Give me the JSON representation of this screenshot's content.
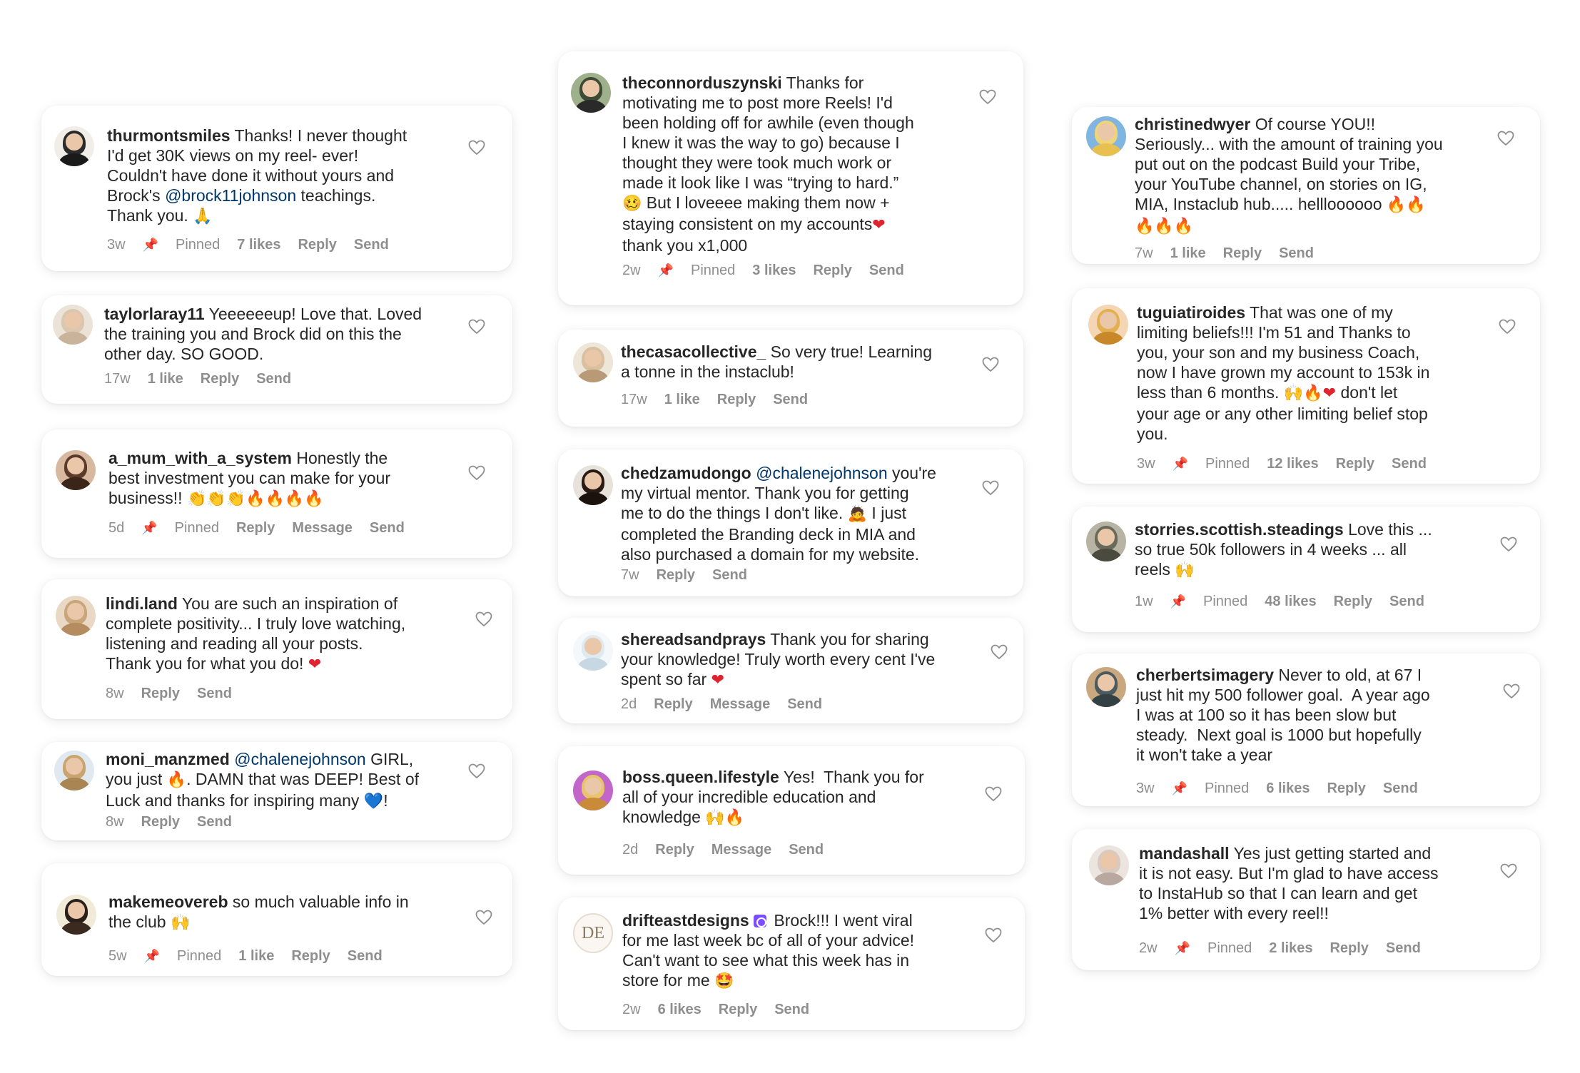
{
  "colors": {
    "text": "#262626",
    "meta": "#8e8e8e",
    "mention": "#00376b",
    "card_bg": "#ffffff"
  },
  "comments": [
    {
      "username": "thurmontsmiles",
      "parts": [
        {
          "text": " Thanks! I never thought"
        },
        {
          "br": true
        },
        {
          "text": "I'd get 30K views on my reel- ever!"
        },
        {
          "br": true
        },
        {
          "text": "Couldn't have done it without yours and"
        },
        {
          "br": true
        },
        {
          "text": "Brock's "
        },
        {
          "mention": "@brock11johnson"
        },
        {
          "text": " teachings."
        },
        {
          "br": true
        },
        {
          "text": "Thank you. "
        },
        {
          "emoji": "🙏",
          "cls": "pray"
        }
      ],
      "time": "3w",
      "pinned": "Pinned",
      "likes": "7 likes",
      "actions": [
        "Reply",
        "Send"
      ],
      "icon": "heart-outline-icon"
    },
    {
      "username": "taylorlaray11",
      "parts": [
        {
          "text": " Yeeeeeeup! Love that. Loved"
        },
        {
          "br": true
        },
        {
          "text": "the training you and Brock did on this the"
        },
        {
          "br": true
        },
        {
          "text": "other day. SO GOOD."
        }
      ],
      "time": "17w",
      "likes": "1 like",
      "actions": [
        "Reply",
        "Send"
      ],
      "icon": "heart-outline-icon"
    },
    {
      "username": "a_mum_with_a_system",
      "parts": [
        {
          "text": " Honestly the"
        },
        {
          "br": true
        },
        {
          "text": "best investment you can make for your"
        },
        {
          "br": true
        },
        {
          "text": "business!! "
        },
        {
          "emoji": "👏👏👏",
          "cls": "clap"
        },
        {
          "emoji": "🔥🔥🔥🔥",
          "cls": "fire"
        }
      ],
      "time": "5d",
      "pinned": "Pinned",
      "actions": [
        "Reply",
        "Message",
        "Send"
      ],
      "icon": "heart-outline-icon"
    },
    {
      "username": "lindi.land",
      "parts": [
        {
          "text": " You are such an inspiration of"
        },
        {
          "br": true
        },
        {
          "text": "complete positivity... I truly love watching,"
        },
        {
          "br": true
        },
        {
          "text": "listening and reading all your posts."
        },
        {
          "br": true
        },
        {
          "text": "Thank you for what you do! "
        },
        {
          "emoji": "❤",
          "cls": "heart"
        }
      ],
      "time": "8w",
      "actions": [
        "Reply",
        "Send"
      ],
      "icon": "heart-outline-icon"
    },
    {
      "username": "moni_manzmed",
      "parts": [
        {
          "text": " "
        },
        {
          "mention": "@chalenejohnson"
        },
        {
          "text": " GIRL,"
        },
        {
          "br": true
        },
        {
          "text": "you just "
        },
        {
          "emoji": "🔥",
          "cls": "fire"
        },
        {
          "text": ". DAMN that was DEEP! Best of"
        },
        {
          "br": true
        },
        {
          "text": "Luck and thanks for inspiring many "
        },
        {
          "emoji": "💙",
          "cls": "blue"
        },
        {
          "text": "!"
        }
      ],
      "time": "8w",
      "actions": [
        "Reply",
        "Send"
      ],
      "icon": "heart-outline-icon"
    },
    {
      "username": "makemeovereb",
      "parts": [
        {
          "text": " so much valuable info in"
        },
        {
          "br": true
        },
        {
          "text": "the club "
        },
        {
          "emoji": "🙌",
          "cls": "yellow"
        }
      ],
      "time": "5w",
      "pinned": "Pinned",
      "likes": "1 like",
      "actions": [
        "Reply",
        "Send"
      ],
      "icon": "heart-outline-icon"
    },
    {
      "username": "theconnorduszynski",
      "parts": [
        {
          "text": " Thanks for"
        },
        {
          "br": true
        },
        {
          "text": "motivating me to post more Reels! I'd"
        },
        {
          "br": true
        },
        {
          "text": "been holding off for awhile (even though"
        },
        {
          "br": true
        },
        {
          "text": "I knew it was the way to go) because I"
        },
        {
          "br": true
        },
        {
          "text": "thought they were took much work or"
        },
        {
          "br": true
        },
        {
          "text": "made it look like I was “trying to hard.”"
        },
        {
          "br": true
        },
        {
          "emoji": "🥴",
          "cls": "yellow"
        },
        {
          "text": " But I loveeee making them now +"
        },
        {
          "br": true
        },
        {
          "text": "staying consistent on my accounts"
        },
        {
          "emoji": "❤",
          "cls": "heart"
        },
        {
          "br": true
        },
        {
          "text": "thank you x1,000"
        }
      ],
      "time": "2w",
      "pinned": "Pinned",
      "likes": "3 likes",
      "actions": [
        "Reply",
        "Send"
      ],
      "icon": "heart-outline-icon"
    },
    {
      "username": "thecasacollective_",
      "parts": [
        {
          "text": " So very true! Learning"
        },
        {
          "br": true
        },
        {
          "text": "a tonne in the instaclub!"
        }
      ],
      "time": "17w",
      "likes": "1 like",
      "actions": [
        "Reply",
        "Send"
      ],
      "icon": "heart-outline-icon"
    },
    {
      "username": "chedzamudongo",
      "parts": [
        {
          "text": " "
        },
        {
          "mention": "@chalenejohnson"
        },
        {
          "text": " you're"
        },
        {
          "br": true
        },
        {
          "text": "my virtual mentor. Thank you for getting"
        },
        {
          "br": true
        },
        {
          "text": "me to do the things I don't like. "
        },
        {
          "emoji": "🙇",
          "cls": "purple"
        },
        {
          "text": " I just"
        },
        {
          "br": true
        },
        {
          "text": "completed the Branding deck in MIA and"
        },
        {
          "br": true
        },
        {
          "text": "also purchased a domain for my website."
        }
      ],
      "time": "7w",
      "actions": [
        "Reply",
        "Send"
      ],
      "icon": "heart-outline-icon"
    },
    {
      "username": "shereadsandprays",
      "parts": [
        {
          "text": " Thank you for sharing"
        },
        {
          "br": true
        },
        {
          "text": "your knowledge! Truly worth every cent I've"
        },
        {
          "br": true
        },
        {
          "text": "spent so far "
        },
        {
          "emoji": "❤",
          "cls": "heart"
        }
      ],
      "time": "2d",
      "actions": [
        "Reply",
        "Message",
        "Send"
      ],
      "icon": "heart-outline-icon"
    },
    {
      "username": "boss.queen.lifestyle",
      "parts": [
        {
          "text": " Yes!  Thank you for"
        },
        {
          "br": true
        },
        {
          "text": "all of your incredible education and"
        },
        {
          "br": true
        },
        {
          "text": "knowledge "
        },
        {
          "emoji": "🙌",
          "cls": "yellow"
        },
        {
          "emoji": "🔥",
          "cls": "fire"
        }
      ],
      "time": "2d",
      "actions": [
        "Reply",
        "Message",
        "Send"
      ],
      "icon": "heart-outline-icon"
    },
    {
      "username": "drifteastdesigns",
      "verified": true,
      "parts": [
        {
          "text": " Brock!!! I went viral"
        },
        {
          "br": true
        },
        {
          "text": "for me last week bc of all of your advice!"
        },
        {
          "br": true
        },
        {
          "text": "Can't want to see what this week has in"
        },
        {
          "br": true
        },
        {
          "text": "store for me "
        },
        {
          "emoji": "🤩",
          "cls": "yellow"
        }
      ],
      "time": "2w",
      "likes": "6 likes",
      "actions": [
        "Reply",
        "Send"
      ],
      "icon": "heart-outline-icon"
    },
    {
      "username": "christinedwyer",
      "parts": [
        {
          "text": " Of course YOU!!"
        },
        {
          "br": true
        },
        {
          "text": "Seriously... with the amount of training you"
        },
        {
          "br": true
        },
        {
          "text": "put out on the podcast Build your Tribe,"
        },
        {
          "br": true
        },
        {
          "text": "your YouTube channel, on stories on IG,"
        },
        {
          "br": true
        },
        {
          "text": "MIA, Instaclub hub..... hellloooooo "
        },
        {
          "emoji": "🔥🔥",
          "cls": "fire"
        },
        {
          "br": true
        },
        {
          "emoji": "🔥🔥🔥",
          "cls": "fire"
        }
      ],
      "time": "7w",
      "likes": "1 like",
      "actions": [
        "Reply",
        "Send"
      ],
      "icon": "heart-outline-icon"
    },
    {
      "username": "tuguiatiroides",
      "parts": [
        {
          "text": " That was one of my"
        },
        {
          "br": true
        },
        {
          "text": "limiting beliefs!!! I'm 51 and Thanks to"
        },
        {
          "br": true
        },
        {
          "text": "you, your son and my business Coach,"
        },
        {
          "br": true
        },
        {
          "text": "now I have grown my account to 153k in"
        },
        {
          "br": true
        },
        {
          "text": "less than 6 months. "
        },
        {
          "emoji": "🙌",
          "cls": "yellow"
        },
        {
          "emoji": "🔥",
          "cls": "fire"
        },
        {
          "emoji": "❤",
          "cls": "heart"
        },
        {
          "text": " don't let"
        },
        {
          "br": true
        },
        {
          "text": "your age or any other limiting belief stop"
        },
        {
          "br": true
        },
        {
          "text": "you."
        }
      ],
      "time": "3w",
      "pinned": "Pinned",
      "likes": "12 likes",
      "actions": [
        "Reply",
        "Send"
      ],
      "icon": "heart-outline-icon"
    },
    {
      "username": "storries.scottish.steadings",
      "parts": [
        {
          "text": " Love this ..."
        },
        {
          "br": true
        },
        {
          "text": "so true 50k followers in 4 weeks ... all"
        },
        {
          "br": true
        },
        {
          "text": "reels "
        },
        {
          "emoji": "🙌",
          "cls": "yellow"
        }
      ],
      "time": "1w",
      "pinned": "Pinned",
      "likes": "48 likes",
      "actions": [
        "Reply",
        "Send"
      ],
      "icon": "heart-outline-icon"
    },
    {
      "username": "cherbertsimagery",
      "parts": [
        {
          "text": " Never to old, at 67 I"
        },
        {
          "br": true
        },
        {
          "text": "just hit my 500 follower goal.  A year ago"
        },
        {
          "br": true
        },
        {
          "text": "I was at 100 so it has been slow but"
        },
        {
          "br": true
        },
        {
          "text": "steady.  Next goal is 1000 but hopefully"
        },
        {
          "br": true
        },
        {
          "text": "it won't take a year"
        }
      ],
      "time": "3w",
      "pinned": "Pinned",
      "likes": "6 likes",
      "actions": [
        "Reply",
        "Send"
      ],
      "icon": "heart-outline-icon"
    },
    {
      "username": "mandashall",
      "parts": [
        {
          "text": " Yes just getting started and"
        },
        {
          "br": true
        },
        {
          "text": "it is not easy. But I'm glad to have access"
        },
        {
          "br": true
        },
        {
          "text": "to InstaHub so that I can learn and get"
        },
        {
          "br": true
        },
        {
          "text": "1% better with every reel!!"
        }
      ],
      "time": "2w",
      "pinned": "Pinned",
      "likes": "2 likes",
      "actions": [
        "Reply",
        "Send"
      ],
      "icon": "heart-outline-icon"
    }
  ]
}
